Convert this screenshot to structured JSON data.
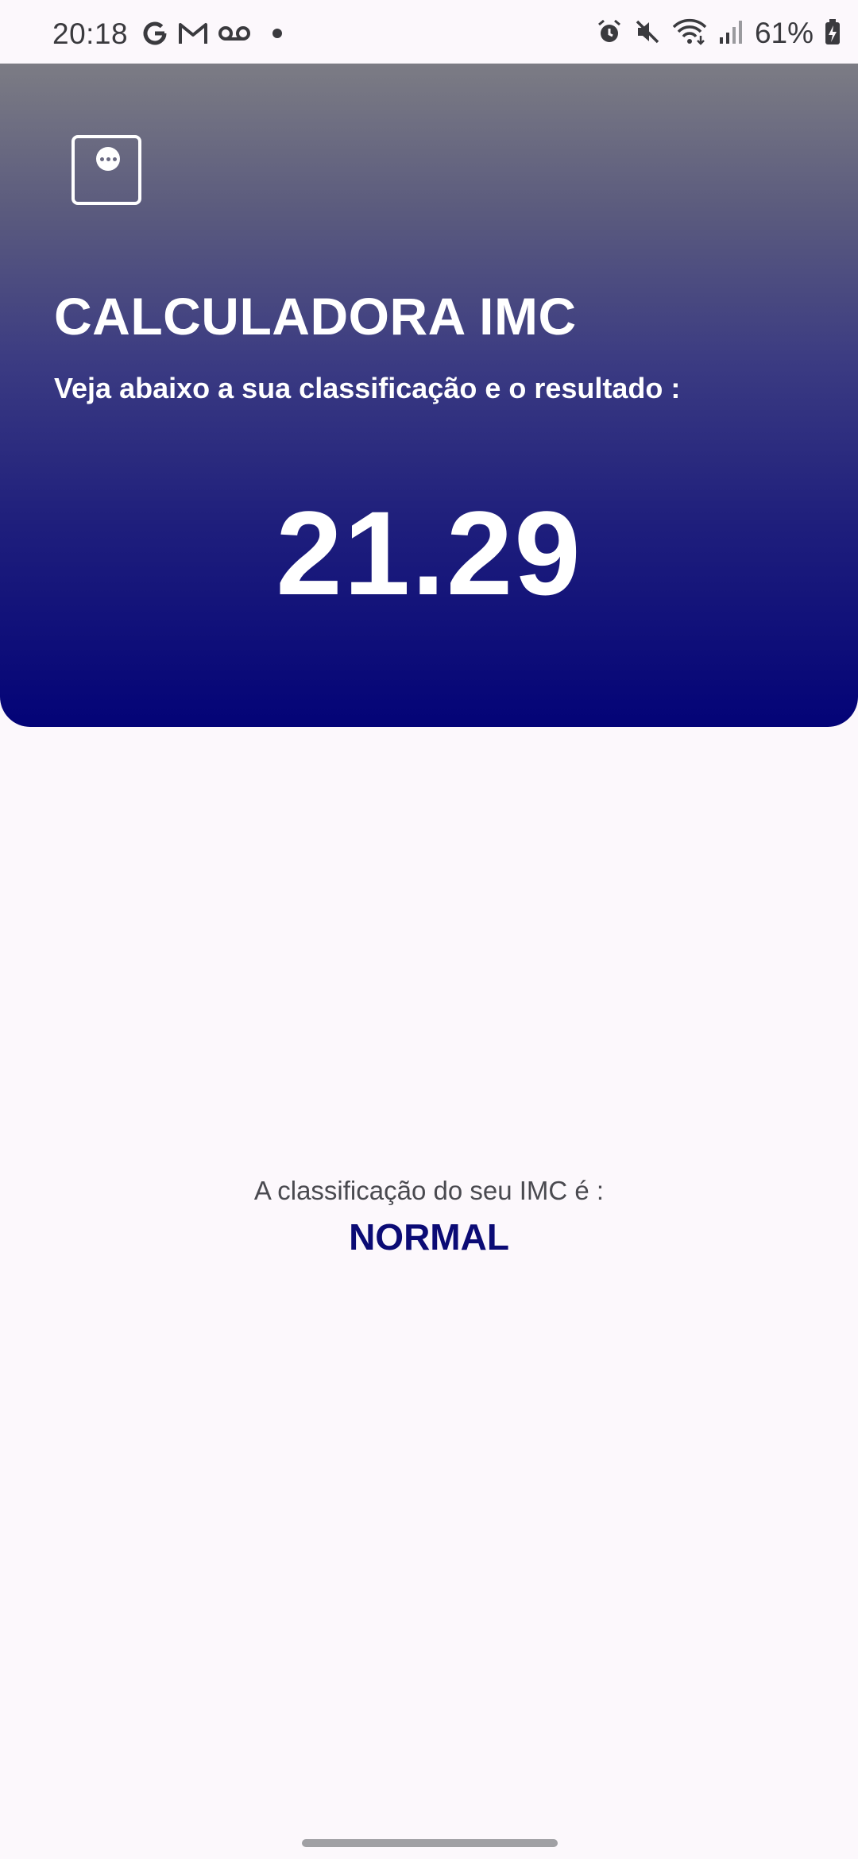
{
  "status_bar": {
    "time": "20:18",
    "left_icons": [
      "google-icon",
      "gmail-icon",
      "voicemail-icon",
      "dot-icon"
    ],
    "right_icons": [
      "alarm-icon",
      "mute-icon",
      "wifi-icon",
      "signal-icon",
      "battery-charging-icon"
    ],
    "battery_text": "61%"
  },
  "header": {
    "menu_icon": "more-options-icon",
    "title": "CALCULADORA IMC",
    "subtitle": "Veja abaixo a sua classificação e o resultado :",
    "result_value": "21.29",
    "gradient_top": "#7c7c84",
    "gradient_bottom": "#030377"
  },
  "classification": {
    "label": "A classificação do seu IMC é :",
    "value": "NORMAL",
    "value_color": "#0b0b75"
  }
}
